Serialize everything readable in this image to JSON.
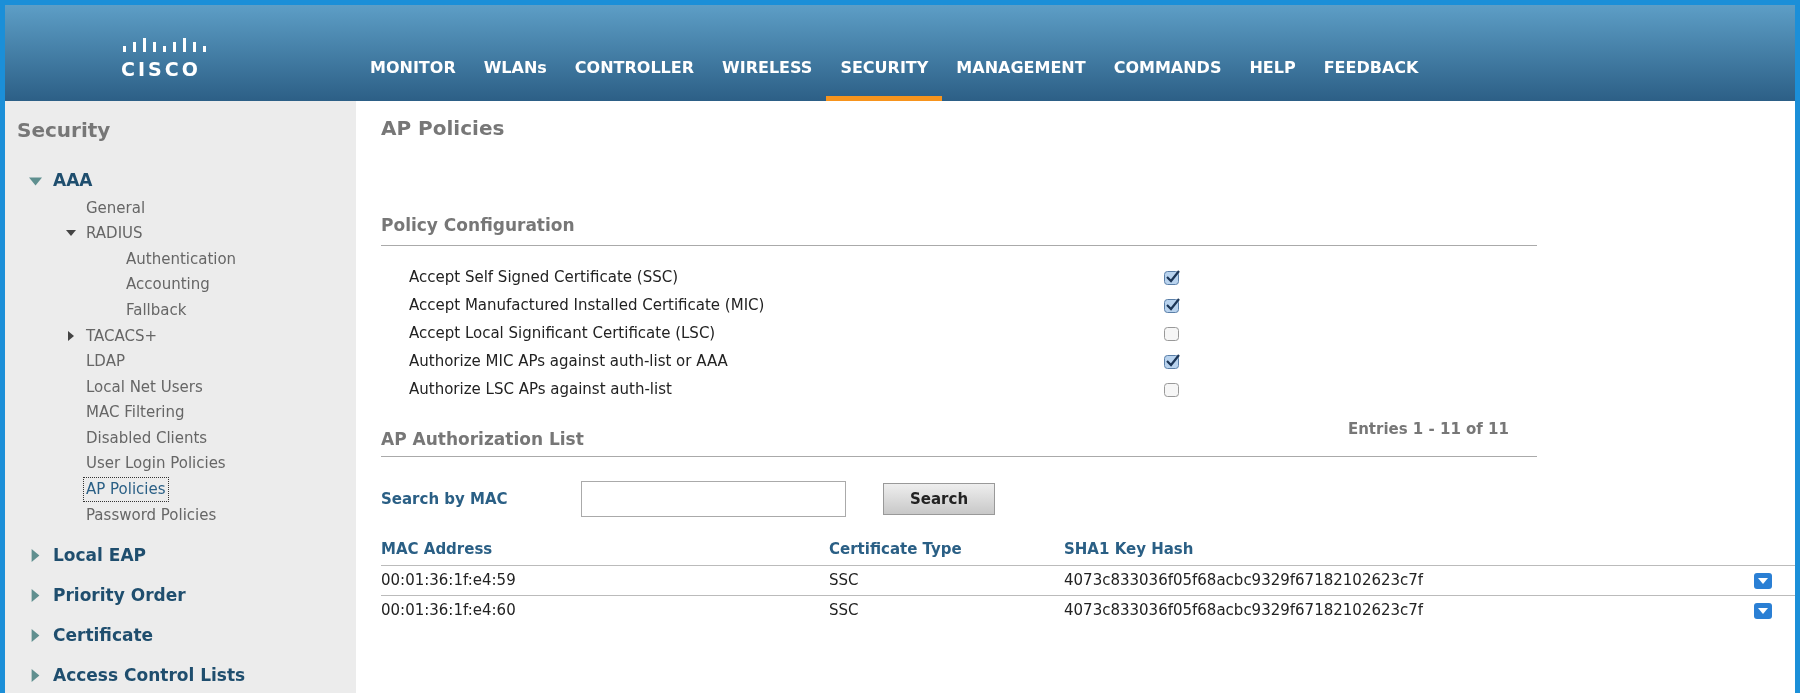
{
  "header": {
    "logo_text": "CISCO",
    "menu": [
      {
        "label": "MONITOR",
        "selected": false
      },
      {
        "label": "WLANs",
        "selected": false
      },
      {
        "label": "CONTROLLER",
        "selected": false
      },
      {
        "label": "WIRELESS",
        "selected": false
      },
      {
        "label": "SECURITY",
        "selected": true
      },
      {
        "label": "MANAGEMENT",
        "selected": false
      },
      {
        "label": "COMMANDS",
        "selected": false
      },
      {
        "label": "HELP",
        "selected": false
      },
      {
        "label": "FEEDBACK",
        "selected": false
      }
    ]
  },
  "sidebar": {
    "title": "Security",
    "items": [
      {
        "label": "AAA",
        "expanded": true,
        "selected": false,
        "children": [
          {
            "label": "General",
            "selected": false
          },
          {
            "label": "RADIUS",
            "expanded": true,
            "selected": false,
            "children": [
              {
                "label": "Authentication",
                "selected": false
              },
              {
                "label": "Accounting",
                "selected": false
              },
              {
                "label": "Fallback",
                "selected": false
              }
            ]
          },
          {
            "label": "TACACS+",
            "expanded": false,
            "selected": false
          },
          {
            "label": "LDAP",
            "selected": false
          },
          {
            "label": "Local Net Users",
            "selected": false
          },
          {
            "label": "MAC Filtering",
            "selected": false
          },
          {
            "label": "Disabled Clients",
            "selected": false
          },
          {
            "label": "User Login Policies",
            "selected": false
          },
          {
            "label": "AP Policies",
            "selected": true
          },
          {
            "label": "Password Policies",
            "selected": false
          }
        ]
      },
      {
        "label": "Local EAP",
        "expanded": false,
        "selected": false
      },
      {
        "label": "Priority Order",
        "expanded": false,
        "selected": false
      },
      {
        "label": "Certificate",
        "expanded": false,
        "selected": false
      },
      {
        "label": "Access Control Lists",
        "expanded": false,
        "selected": false
      }
    ]
  },
  "page_title": "AP Policies",
  "policy": {
    "heading": "Policy Configuration",
    "options": [
      {
        "label": "Accept Self Signed Certificate (SSC)",
        "checked": true
      },
      {
        "label": "Accept Manufactured Installed Certificate (MIC)",
        "checked": true
      },
      {
        "label": "Accept Local Significant Certificate (LSC)",
        "checked": false
      },
      {
        "label": "Authorize MIC APs against auth-list or AAA",
        "checked": true
      },
      {
        "label": "Authorize LSC APs against auth-list",
        "checked": false
      }
    ]
  },
  "auth_list": {
    "heading": "AP Authorization List",
    "entries": "Entries 1 - 11 of 11",
    "search": {
      "label": "Search by MAC",
      "button": "Search"
    },
    "table": {
      "columns": [
        "MAC Address",
        "Certificate Type",
        "SHA1 Key Hash"
      ],
      "rows": [
        [
          "00:01:36:1f:e4:59",
          "SSC",
          "4073c833036f05f68acbc9329f67182102623c7f"
        ],
        [
          "00:01:36:1f:e4:60",
          "SSC",
          "4073c833036f05f68acbc9329f67182102623c7f"
        ]
      ]
    }
  }
}
